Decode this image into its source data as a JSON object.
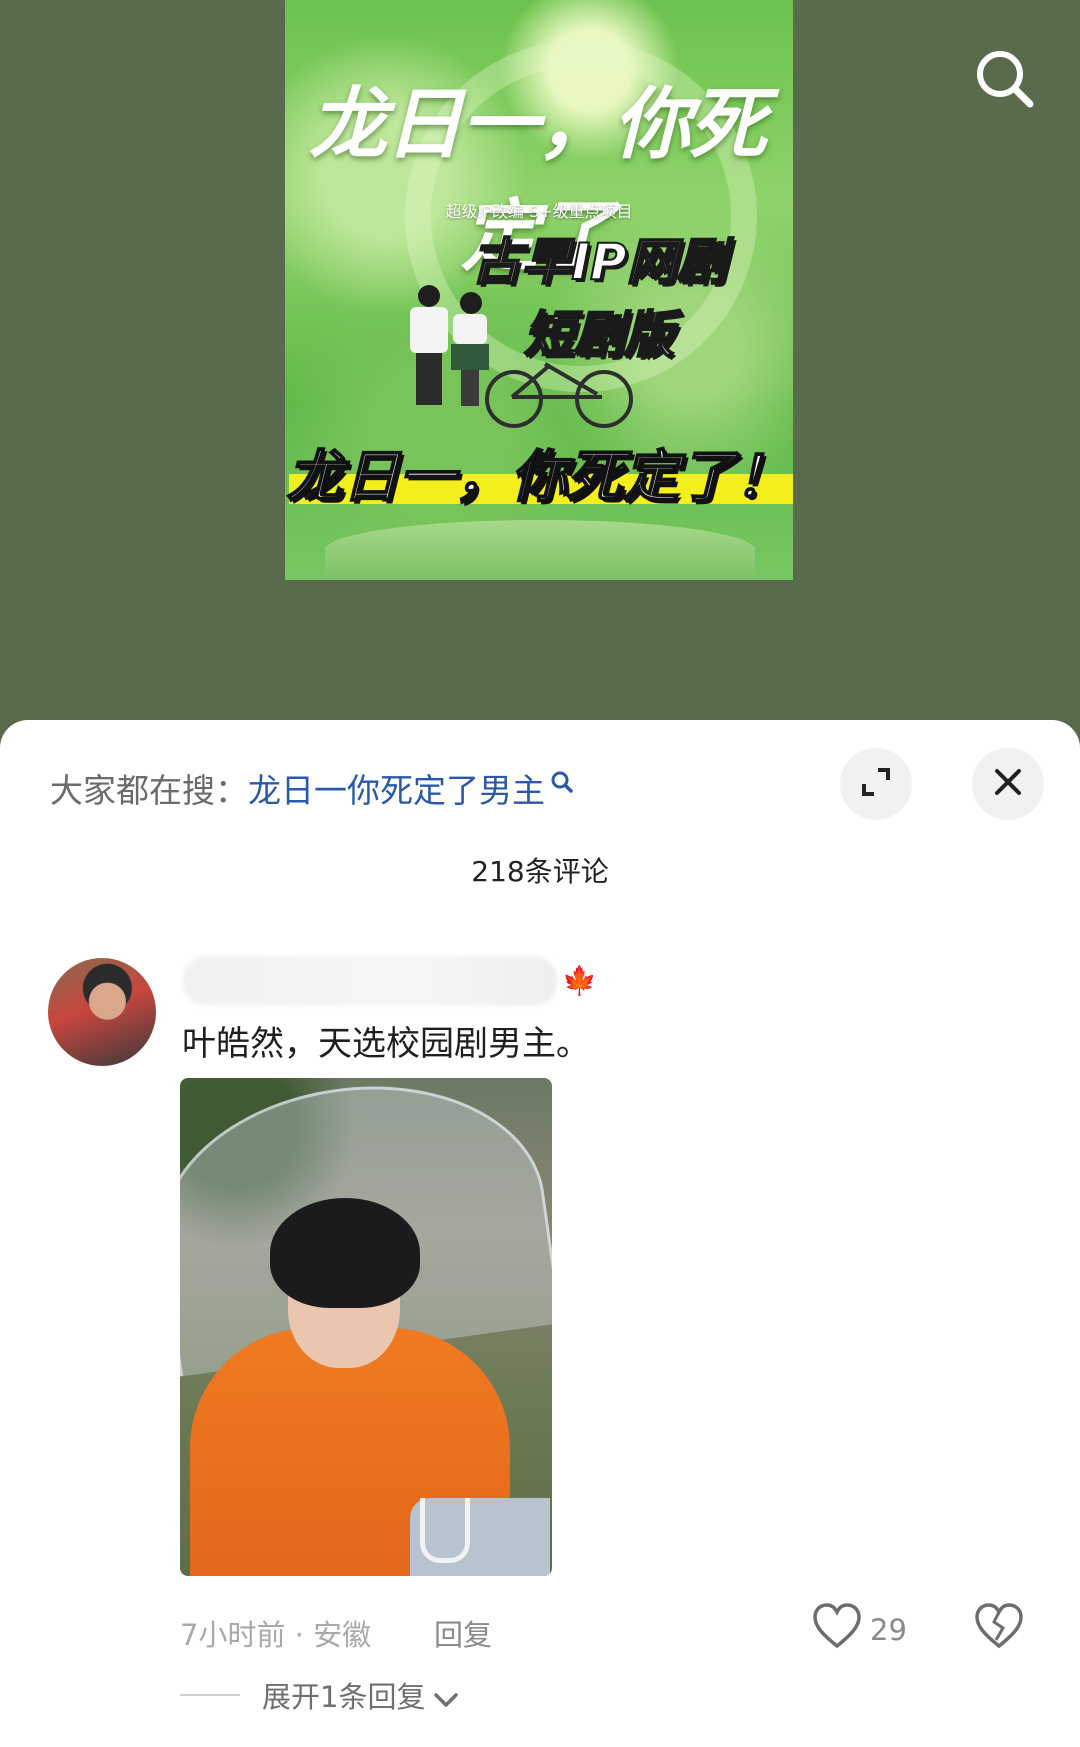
{
  "poster": {
    "title": "龙日一，你死定了",
    "subline": "超级IP改编  S+级重点项目",
    "tag_line1": "古早IP网剧",
    "tag_line2": "短剧版",
    "bottom_title": "龙日一，你死定了！"
  },
  "top_bar": {
    "search_icon": "search-icon"
  },
  "sheet": {
    "hot_search_prefix": "大家都在搜：",
    "hot_search_keyword": "龙日一你死定了男主",
    "comment_count": "218条评论"
  },
  "comment": {
    "text": "叶皓然，天选校园剧男主。",
    "time": "7小时前",
    "location": "安徽",
    "reply_label": "回复",
    "likes": "29",
    "expand_label": "展开1条回复"
  },
  "colors": {
    "background": "#596b4c",
    "keyword": "#2a5aa7",
    "sheet": "#ffffff"
  }
}
